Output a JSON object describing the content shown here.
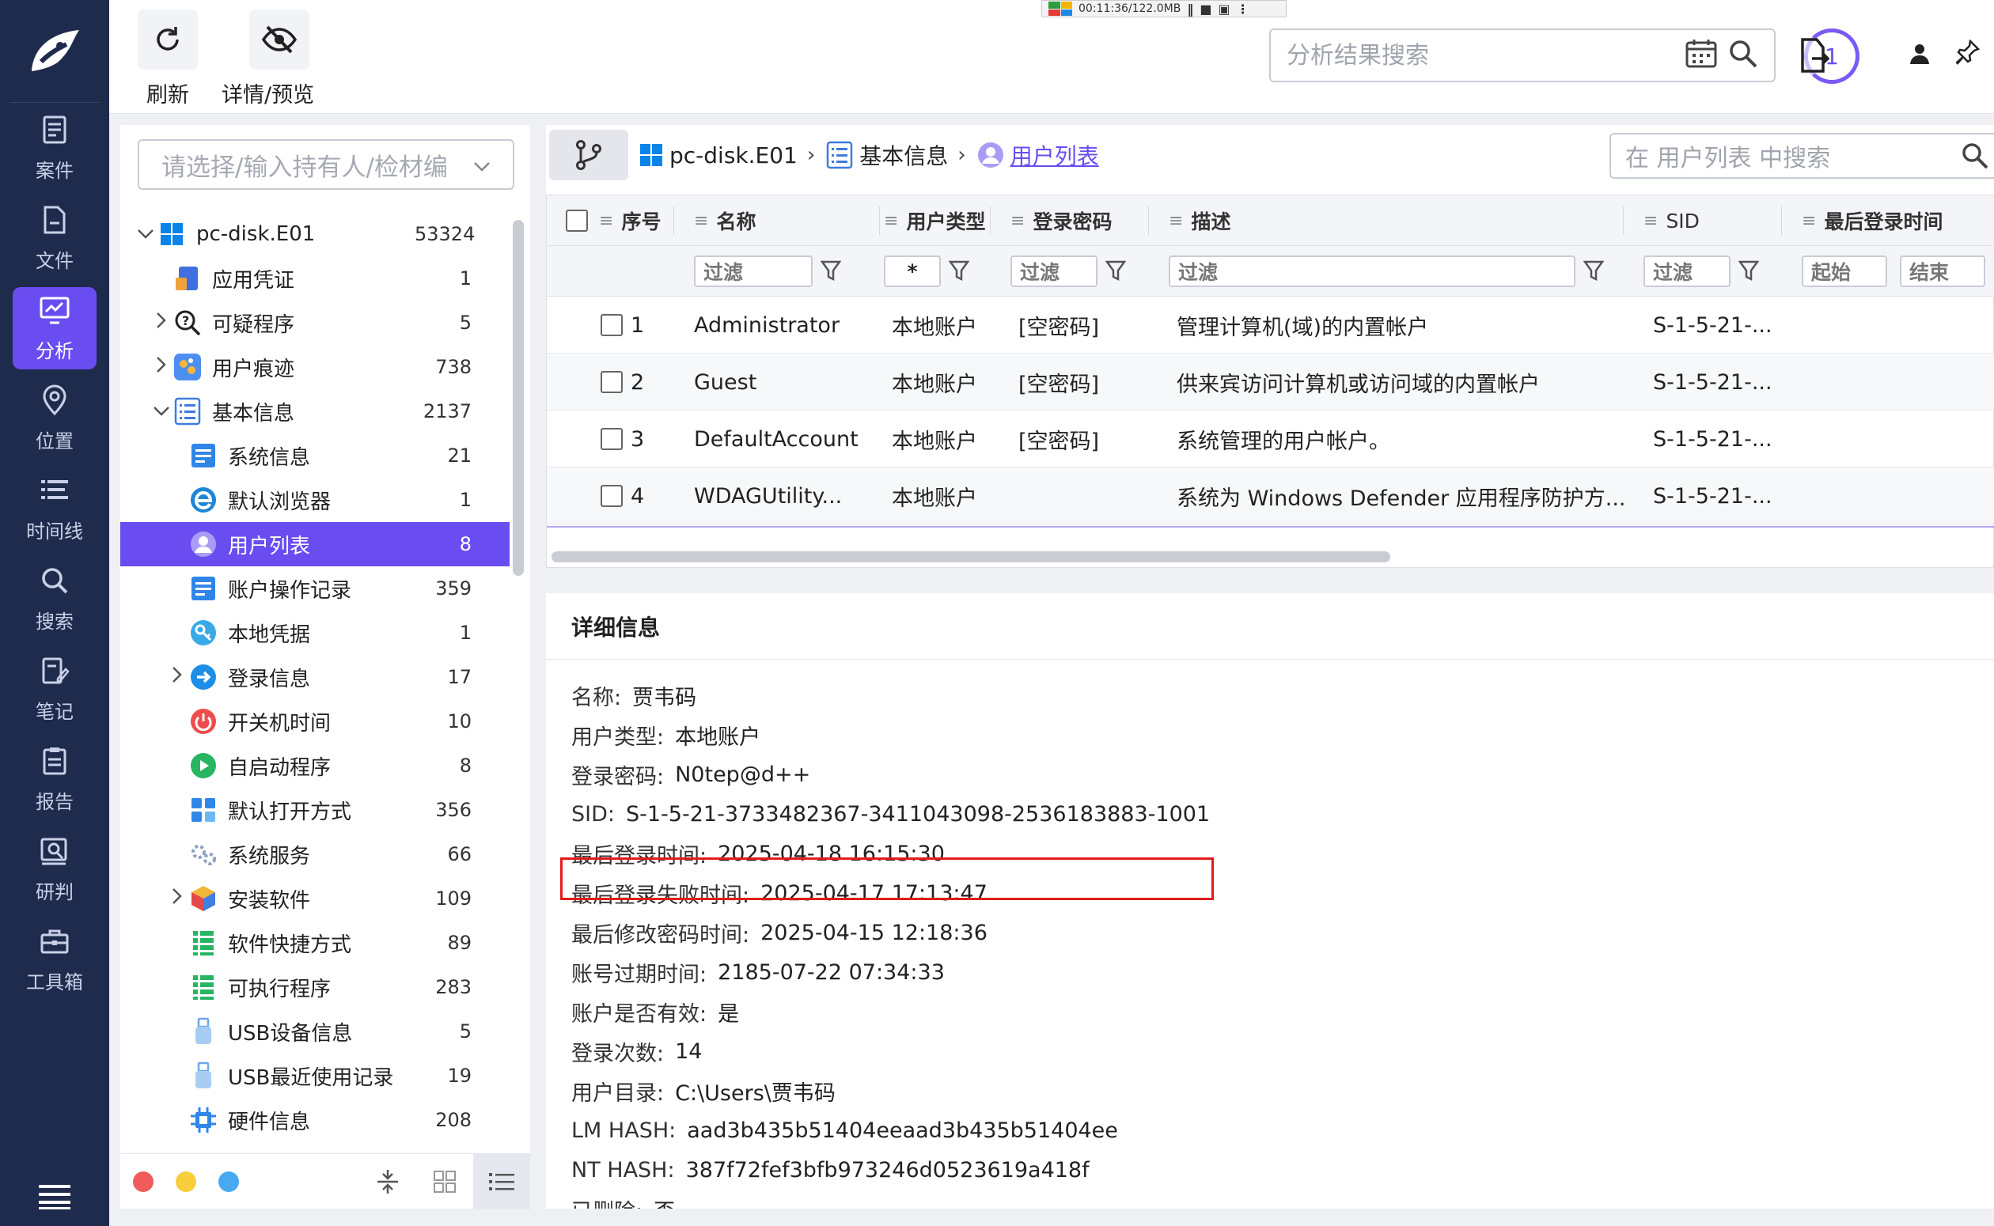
{
  "recorder": {
    "text": "00:11:36/122.0MB"
  },
  "nav": {
    "items": [
      {
        "label": "案件",
        "icon": "case-icon"
      },
      {
        "label": "文件",
        "icon": "file-icon"
      },
      {
        "label": "分析",
        "icon": "analysis-icon",
        "active": true
      },
      {
        "label": "位置",
        "icon": "location-icon"
      },
      {
        "label": "时间线",
        "icon": "timeline-icon"
      },
      {
        "label": "搜索",
        "icon": "search-icon"
      },
      {
        "label": "笔记",
        "icon": "note-icon"
      },
      {
        "label": "报告",
        "icon": "report-icon"
      },
      {
        "label": "研判",
        "icon": "judge-icon"
      },
      {
        "label": "工具箱",
        "icon": "toolbox-icon"
      }
    ]
  },
  "toolbar": {
    "refresh_label": "刷新",
    "preview_label": "详情/预览",
    "search_placeholder": "分析结果搜索",
    "task_count": "1"
  },
  "tree": {
    "holder_placeholder": "请选择/输入持有人/检材编",
    "items": [
      {
        "label": "pc-disk.E01",
        "count": "53324",
        "level": 0,
        "chev": "v",
        "icon": "windows-icon",
        "selected": false
      },
      {
        "label": "应用凭证",
        "count": "1",
        "level": 1,
        "chev": "",
        "icon": "credential-icon",
        "selected": false
      },
      {
        "label": "可疑程序",
        "count": "5",
        "level": 1,
        "chev": ">",
        "icon": "suspicious-icon",
        "selected": false
      },
      {
        "label": "用户痕迹",
        "count": "738",
        "level": 1,
        "chev": ">",
        "icon": "trace-icon",
        "selected": false
      },
      {
        "label": "基本信息",
        "count": "2137",
        "level": 1,
        "chev": "v",
        "icon": "list-icon",
        "selected": false
      },
      {
        "label": "系统信息",
        "count": "21",
        "level": 2,
        "chev": "",
        "icon": "sysinfo-icon",
        "selected": false
      },
      {
        "label": "默认浏览器",
        "count": "1",
        "level": 2,
        "chev": "",
        "icon": "browser-icon",
        "selected": false
      },
      {
        "label": "用户列表",
        "count": "8",
        "level": 2,
        "chev": "",
        "icon": "user-icon",
        "selected": true
      },
      {
        "label": "账户操作记录",
        "count": "359",
        "level": 2,
        "chev": "",
        "icon": "account-log-icon",
        "selected": false
      },
      {
        "label": "本地凭据",
        "count": "1",
        "level": 2,
        "chev": "",
        "icon": "key-icon",
        "selected": false
      },
      {
        "label": "登录信息",
        "count": "17",
        "level": 2,
        "chev": ">",
        "icon": "login-icon",
        "selected": false
      },
      {
        "label": "开关机时间",
        "count": "10",
        "level": 2,
        "chev": "",
        "icon": "power-icon",
        "selected": false
      },
      {
        "label": "自启动程序",
        "count": "8",
        "level": 2,
        "chev": "",
        "icon": "autostart-icon",
        "selected": false
      },
      {
        "label": "默认打开方式",
        "count": "356",
        "level": 2,
        "chev": "",
        "icon": "open-with-icon",
        "selected": false
      },
      {
        "label": "系统服务",
        "count": "66",
        "level": 2,
        "chev": "",
        "icon": "service-icon",
        "selected": false
      },
      {
        "label": "安装软件",
        "count": "109",
        "level": 2,
        "chev": ">",
        "icon": "software-icon",
        "selected": false
      },
      {
        "label": "软件快捷方式",
        "count": "89",
        "level": 2,
        "chev": "",
        "icon": "shortcut-icon",
        "selected": false
      },
      {
        "label": "可执行程序",
        "count": "283",
        "level": 2,
        "chev": "",
        "icon": "exe-icon",
        "selected": false
      },
      {
        "label": "USB设备信息",
        "count": "5",
        "level": 2,
        "chev": "",
        "icon": "usb-icon",
        "selected": false
      },
      {
        "label": "USB最近使用记录",
        "count": "19",
        "level": 2,
        "chev": "",
        "icon": "usb-history-icon",
        "selected": false
      },
      {
        "label": "硬件信息",
        "count": "208",
        "level": 2,
        "chev": "",
        "icon": "hardware-icon",
        "selected": false
      }
    ]
  },
  "breadcrumb": {
    "items": [
      "pc-disk.E01",
      "基本信息",
      "用户列表"
    ],
    "search_placeholder": "在 用户列表 中搜索"
  },
  "table": {
    "columns": [
      "序号",
      "名称",
      "用户类型",
      "登录密码",
      "描述",
      "SID",
      "最后登录时间"
    ],
    "filters": {
      "generic": "过滤",
      "user_type": "*",
      "start": "起始",
      "end": "结束"
    },
    "rows": [
      {
        "no": "1",
        "name": "Administrator",
        "type": "本地账户",
        "pwd": "[空密码]",
        "desc": "管理计算机(域)的内置帐户",
        "sid": "S-1-5-21-...",
        "last": ""
      },
      {
        "no": "2",
        "name": "Guest",
        "type": "本地账户",
        "pwd": "[空密码]",
        "desc": "供来宾访问计算机或访问域的内置帐户",
        "sid": "S-1-5-21-...",
        "last": ""
      },
      {
        "no": "3",
        "name": "DefaultAccount",
        "type": "本地账户",
        "pwd": "[空密码]",
        "desc": "系统管理的用户帐户。",
        "sid": "S-1-5-21-...",
        "last": ""
      },
      {
        "no": "4",
        "name": "WDAGUtility...",
        "type": "本地账户",
        "pwd": "",
        "desc": "系统为 Windows Defender 应用程序防护方...",
        "sid": "S-1-5-21-...",
        "last": ""
      }
    ]
  },
  "detail": {
    "title": "详细信息",
    "fields": [
      {
        "k": "名称:",
        "v": "贾韦码"
      },
      {
        "k": "用户类型:",
        "v": "本地账户"
      },
      {
        "k": "登录密码:",
        "v": "N0tep@d++"
      },
      {
        "k": "SID:",
        "v": "S-1-5-21-3733482367-3411043098-2536183883-1001"
      },
      {
        "k": "最后登录时间:",
        "v": "2025-04-18 16:15:30"
      },
      {
        "k": "最后登录失败时间:",
        "v": "2025-04-17 17:13:47"
      },
      {
        "k": "最后修改密码时间:",
        "v": "2025-04-15 12:18:36"
      },
      {
        "k": "账号过期时间:",
        "v": "2185-07-22 07:34:33"
      },
      {
        "k": "账户是否有效:",
        "v": "是"
      },
      {
        "k": "登录次数:",
        "v": "14"
      },
      {
        "k": "用户目录:",
        "v": "C:\\Users\\贾韦码"
      },
      {
        "k": "LM HASH:",
        "v": "aad3b435b51404eeaad3b435b51404ee"
      },
      {
        "k": "NT HASH:",
        "v": "387f72fef3bfb973246d0523619a418f"
      },
      {
        "k": "已删除:",
        "v": "否"
      }
    ]
  },
  "colors": {
    "accent": "#6a4df0",
    "nav_bg": "#1f2b4d",
    "highlight": "#e31b1b"
  }
}
